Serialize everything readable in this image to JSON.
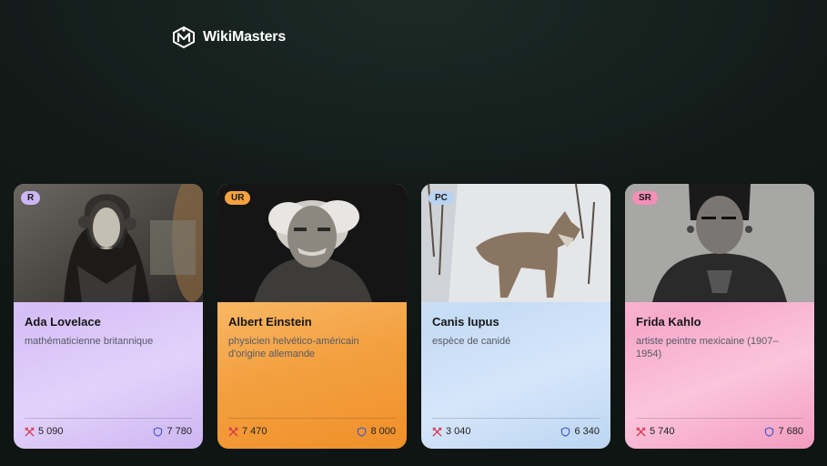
{
  "app": {
    "brand": "WikiMasters"
  },
  "cards": [
    {
      "rarity": "R",
      "rarity_color": "#cbb6f3",
      "name": "Ada Lovelace",
      "description": "mathématicienne britannique",
      "attack": "5 090",
      "defense": "7 780"
    },
    {
      "rarity": "UR",
      "rarity_color": "#f6a23e",
      "name": "Albert Einstein",
      "description": "physicien helvético-américain d'origine allemande",
      "attack": "7 470",
      "defense": "8 000"
    },
    {
      "rarity": "PC",
      "rarity_color": "#b9d3f3",
      "name": "Canis lupus",
      "description": "espèce de canidé",
      "attack": "3 040",
      "defense": "6 340"
    },
    {
      "rarity": "SR",
      "rarity_color": "#f48fb8",
      "name": "Frida Kahlo",
      "description": "artiste peintre mexicaine (1907–1954)",
      "attack": "5 740",
      "defense": "7 680"
    }
  ],
  "icons": {
    "logo": "wikimasters-logo-icon",
    "attack": "crossed-swords-icon",
    "defense": "shield-icon"
  }
}
